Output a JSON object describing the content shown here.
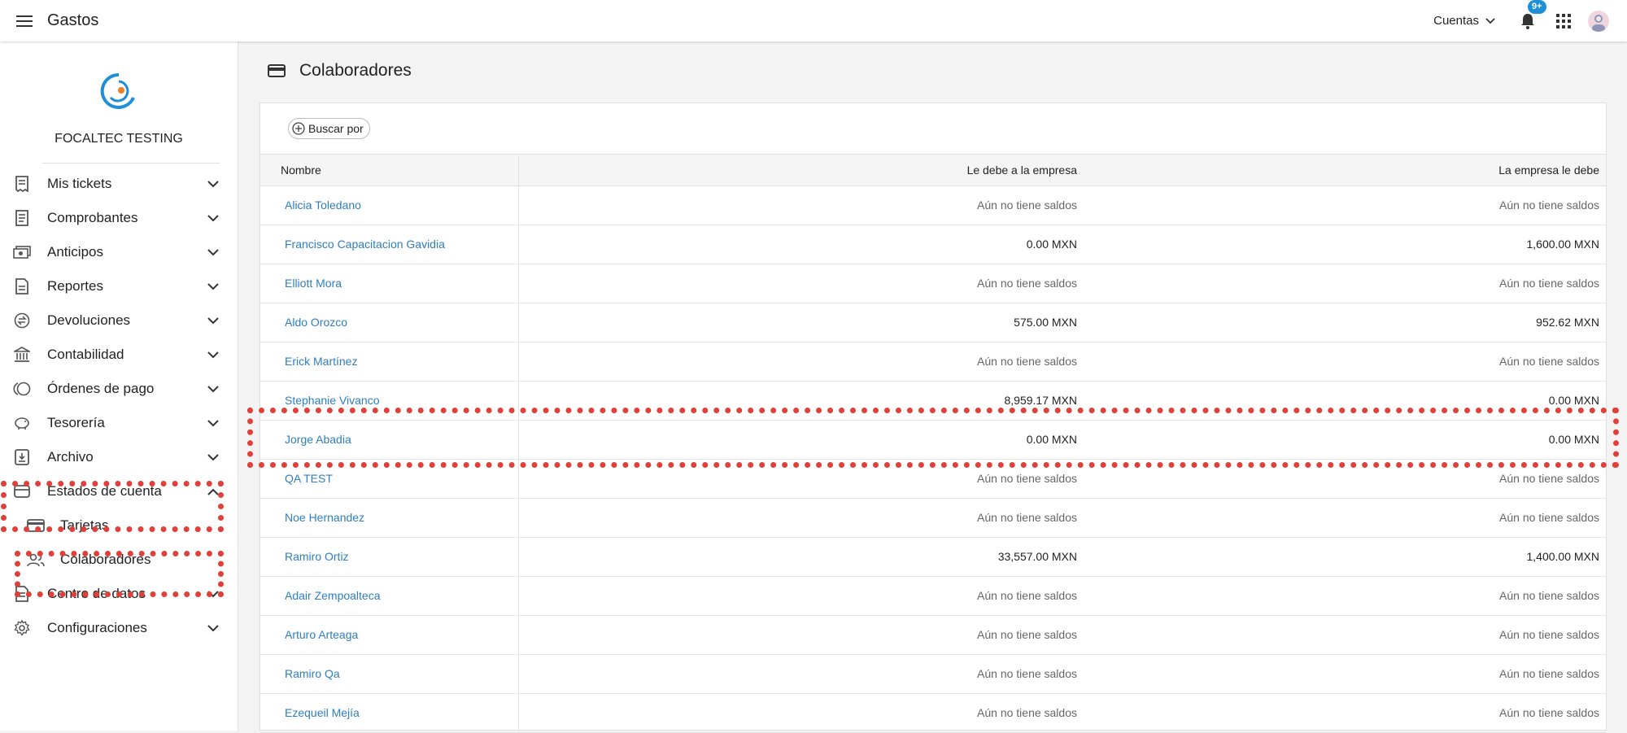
{
  "app": {
    "title": "Gastos"
  },
  "topbar": {
    "accounts_label": "Cuentas",
    "notifications_badge": "9+",
    "accent_color": "#1f8fd8"
  },
  "sidebar": {
    "company": "FOCALTEC TESTING",
    "items": [
      {
        "label": "Mis tickets",
        "icon": "receipt-icon",
        "expanded": false
      },
      {
        "label": "Comprobantes",
        "icon": "document-icon",
        "expanded": false
      },
      {
        "label": "Anticipos",
        "icon": "cash-icon",
        "expanded": false
      },
      {
        "label": "Reportes",
        "icon": "report-icon",
        "expanded": false
      },
      {
        "label": "Devoluciones",
        "icon": "exchange-icon",
        "expanded": false
      },
      {
        "label": "Contabilidad",
        "icon": "bank-icon",
        "expanded": false
      },
      {
        "label": "Órdenes de pago",
        "icon": "coins-icon",
        "expanded": false
      },
      {
        "label": "Tesorería",
        "icon": "piggy-bank-icon",
        "expanded": false
      },
      {
        "label": "Archivo",
        "icon": "archive-icon",
        "expanded": false
      },
      {
        "label": "Estados de cuenta",
        "icon": "wallet-icon",
        "expanded": true
      },
      {
        "label": "Centro de datos",
        "icon": "data-icon",
        "expanded": false
      },
      {
        "label": "Configuraciones",
        "icon": "gear-icon",
        "expanded": false
      }
    ],
    "subitems": [
      {
        "label": "Tarjetas",
        "icon": "card-icon"
      },
      {
        "label": "Colaboradores",
        "icon": "people-icon"
      }
    ]
  },
  "main": {
    "title": "Colaboradores",
    "search_label": "Buscar por",
    "columns": [
      "Nombre",
      "Le debe a la empresa",
      "La empresa le debe"
    ],
    "rows": [
      {
        "name": "Alicia Toledano",
        "owes": "Aún no tiene saldos",
        "owed": "Aún no tiene saldos"
      },
      {
        "name": "Francisco Capacitacion Gavidia",
        "owes": "0.00 MXN",
        "owed": "1,600.00 MXN"
      },
      {
        "name": "Elliott Mora",
        "owes": "Aún no tiene saldos",
        "owed": "Aún no tiene saldos"
      },
      {
        "name": "Aldo Orozco",
        "owes": "575.00 MXN",
        "owed": "952.62 MXN"
      },
      {
        "name": "Erick Martínez",
        "owes": "Aún no tiene saldos",
        "owed": "Aún no tiene saldos"
      },
      {
        "name": "Stephanie Vivanco",
        "owes": "8,959.17 MXN",
        "owed": "0.00 MXN"
      },
      {
        "name": "Jorge Abadia",
        "owes": "0.00 MXN",
        "owed": "0.00 MXN"
      },
      {
        "name": "QA TEST",
        "owes": "Aún no tiene saldos",
        "owed": "Aún no tiene saldos"
      },
      {
        "name": "Noe Hernandez",
        "owes": "Aún no tiene saldos",
        "owed": "Aún no tiene saldos"
      },
      {
        "name": "Ramiro Ortiz",
        "owes": "33,557.00 MXN",
        "owed": "1,400.00 MXN"
      },
      {
        "name": "Adair Zempoalteca",
        "owes": "Aún no tiene saldos",
        "owed": "Aún no tiene saldos"
      },
      {
        "name": "Arturo Arteaga",
        "owes": "Aún no tiene saldos",
        "owed": "Aún no tiene saldos"
      },
      {
        "name": "Ramiro Qa",
        "owes": "Aún no tiene saldos",
        "owed": "Aún no tiene saldos"
      },
      {
        "name": "Ezequeil Mejía",
        "owes": "Aún no tiene saldos",
        "owed": "Aún no tiene saldos"
      }
    ]
  },
  "colors": {
    "link": "#2d7ec2",
    "highlight": "#e0403a"
  }
}
